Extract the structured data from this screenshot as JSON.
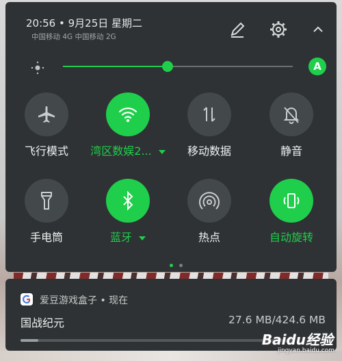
{
  "status": {
    "time_date": "20:56 • 9月25日 星期二",
    "carriers": "中国移动 4G  中国移动 2G"
  },
  "header_icons": [
    "edit-icon",
    "settings-icon",
    "chevron-up-icon"
  ],
  "brightness": {
    "level": 0.455,
    "auto_label": "A",
    "accent_color": "#1fcf4b"
  },
  "tiles": [
    {
      "label": "飞行模式",
      "icon": "airplane-icon",
      "on": false
    },
    {
      "label": "湾区数娱2...",
      "icon": "wifi-icon",
      "on": true,
      "has_dropdown": true
    },
    {
      "label": "移动数据",
      "icon": "mobile-data-icon",
      "on": false
    },
    {
      "label": "静音",
      "icon": "bell-off-icon",
      "on": false
    },
    {
      "label": "手电筒",
      "icon": "flashlight-icon",
      "on": false
    },
    {
      "label": "蓝牙",
      "icon": "bluetooth-icon",
      "on": true,
      "has_dropdown": true
    },
    {
      "label": "热点",
      "icon": "hotspot-icon",
      "on": false
    },
    {
      "label": "自动旋转",
      "icon": "auto-rotate-icon",
      "on": true
    }
  ],
  "pager": {
    "pages": 2,
    "current": 1
  },
  "notification": {
    "app_line": "爱豆游戏盒子 • 现在",
    "title": "国战纪元",
    "size": "27.6 MB/424.6 MB",
    "progress": 0.065
  },
  "watermark": {
    "logo": "Baidu经验",
    "url": "jingyan.baidu.com"
  },
  "colors": {
    "panel": "#2e3234",
    "tile_off": "#43484a",
    "tile_on": "#1fcf4b"
  }
}
